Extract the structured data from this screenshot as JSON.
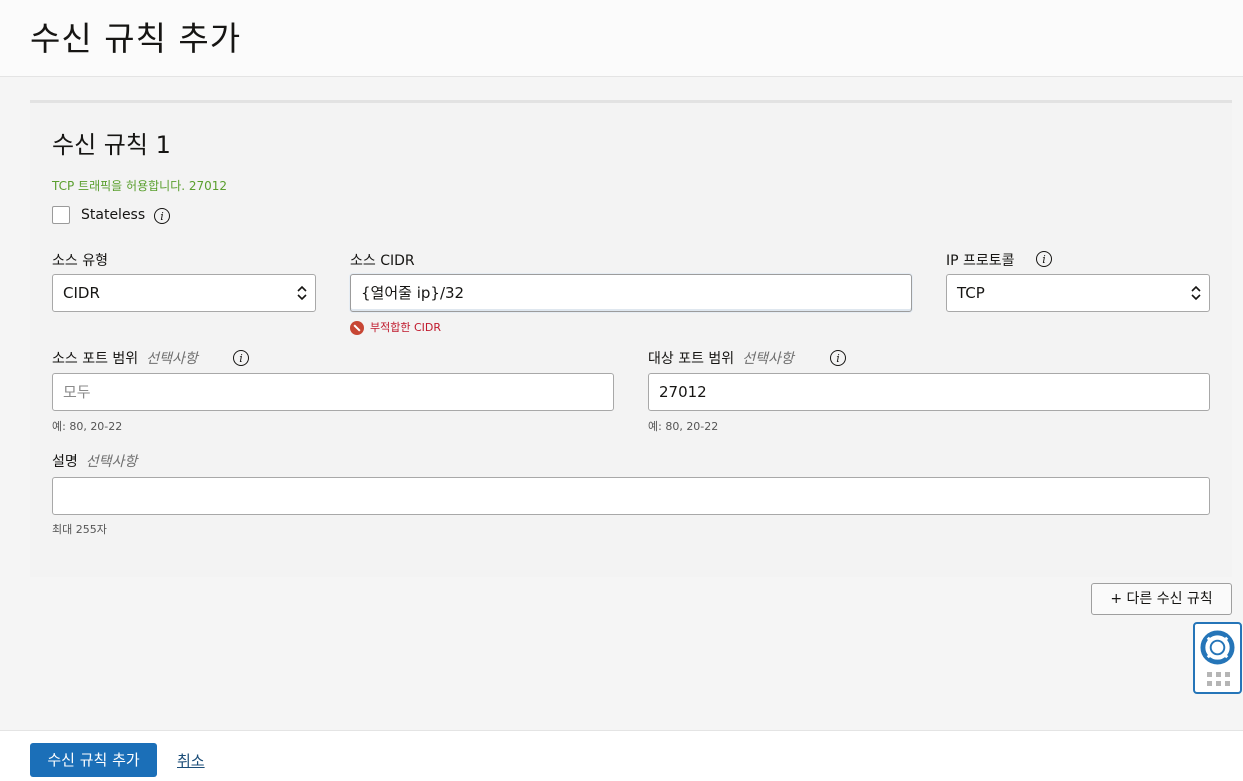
{
  "page": {
    "title": "수신 규칙 추가"
  },
  "rule": {
    "title": "수신 규칙 1",
    "summary": "TCP 트래픽을 허용합니다. 27012",
    "stateless_label": "Stateless",
    "stateless_checked": false,
    "source_type": {
      "label": "소스 유형",
      "value": "CIDR"
    },
    "source_cidr": {
      "label": "소스 CIDR",
      "value": "{열어줄 ip}/32",
      "error": "부적합한 CIDR"
    },
    "ip_protocol": {
      "label": "IP 프로토콜",
      "value": "TCP"
    },
    "source_port": {
      "label": "소스 포트 범위",
      "optional": "선택사항",
      "placeholder": "모두",
      "value": "",
      "hint": "예: 80, 20-22"
    },
    "dest_port": {
      "label": "대상 포트 범위",
      "optional": "선택사항",
      "value": "27012",
      "hint": "예: 80, 20-22"
    },
    "description": {
      "label": "설명",
      "optional": "선택사항",
      "value": "",
      "hint": "최대 255자"
    }
  },
  "actions": {
    "add_another": "+ 다른 수신 규칙",
    "submit": "수신 규칙 추가",
    "cancel": "취소"
  },
  "icons": {
    "info": "info-icon",
    "error": "error-icon",
    "help": "lifebuoy-icon",
    "grid": "grid-icon"
  },
  "colors": {
    "primary": "#1b6fb8",
    "summary_green": "#5a9f2e",
    "error_red": "#c0192c",
    "help_border": "#2575b8"
  }
}
